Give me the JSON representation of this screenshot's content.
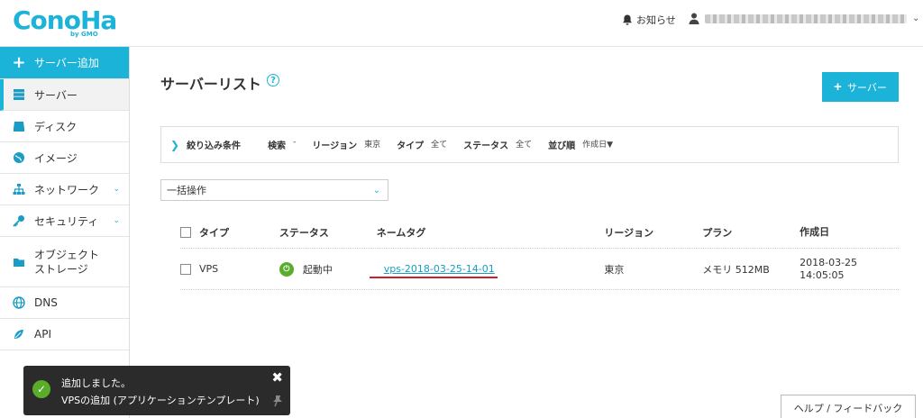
{
  "header": {
    "logo_text": "ConoHa",
    "logo_sub": "by GMO",
    "notice_label": "お知らせ"
  },
  "sidebar": {
    "items": [
      {
        "label": "サーバー追加",
        "icon": "plus-icon"
      },
      {
        "label": "サーバー",
        "icon": "server-icon"
      },
      {
        "label": "ディスク",
        "icon": "disk-icon"
      },
      {
        "label": "イメージ",
        "icon": "globe-icon"
      },
      {
        "label": "ネットワーク",
        "icon": "network-icon"
      },
      {
        "label": "セキュリティ",
        "icon": "key-icon"
      },
      {
        "label": "オブジェクト",
        "label2": "ストレージ",
        "icon": "folder-icon"
      },
      {
        "label": "DNS",
        "icon": "dns-icon"
      },
      {
        "label": "API",
        "icon": "api-icon"
      }
    ]
  },
  "main": {
    "title": "サーバーリスト",
    "help_glyph": "?",
    "add_button_label": "サーバー",
    "filter": {
      "title": "絞り込み条件",
      "search_label": "検索",
      "search_value": "-",
      "region_label": "リージョン",
      "region_value": "東京",
      "type_label": "タイプ",
      "type_value": "全て",
      "status_label": "ステータス",
      "status_value": "全て",
      "sort_label": "並び順",
      "sort_value": "作成日▼"
    },
    "bulk_select": "一括操作",
    "table": {
      "headers": [
        "タイプ",
        "ステータス",
        "ネームタグ",
        "リージョン",
        "プラン",
        "作成日"
      ],
      "rows": [
        {
          "type": "VPS",
          "status": "起動中",
          "nametag": "vps-2018-03-25-14-01",
          "region": "東京",
          "plan": "メモリ 512MB",
          "created_date": "2018-03-25",
          "created_time": "14:05:05"
        }
      ]
    }
  },
  "toast": {
    "line1": "追加しました。",
    "line2": "VPSの追加 (アプリケーションテンプレート)"
  },
  "help_feedback_label": "ヘルプ / フィードバック",
  "colors": {
    "accent": "#1cb3d8",
    "success": "#5aad2a",
    "highlight": "#d21f27"
  }
}
